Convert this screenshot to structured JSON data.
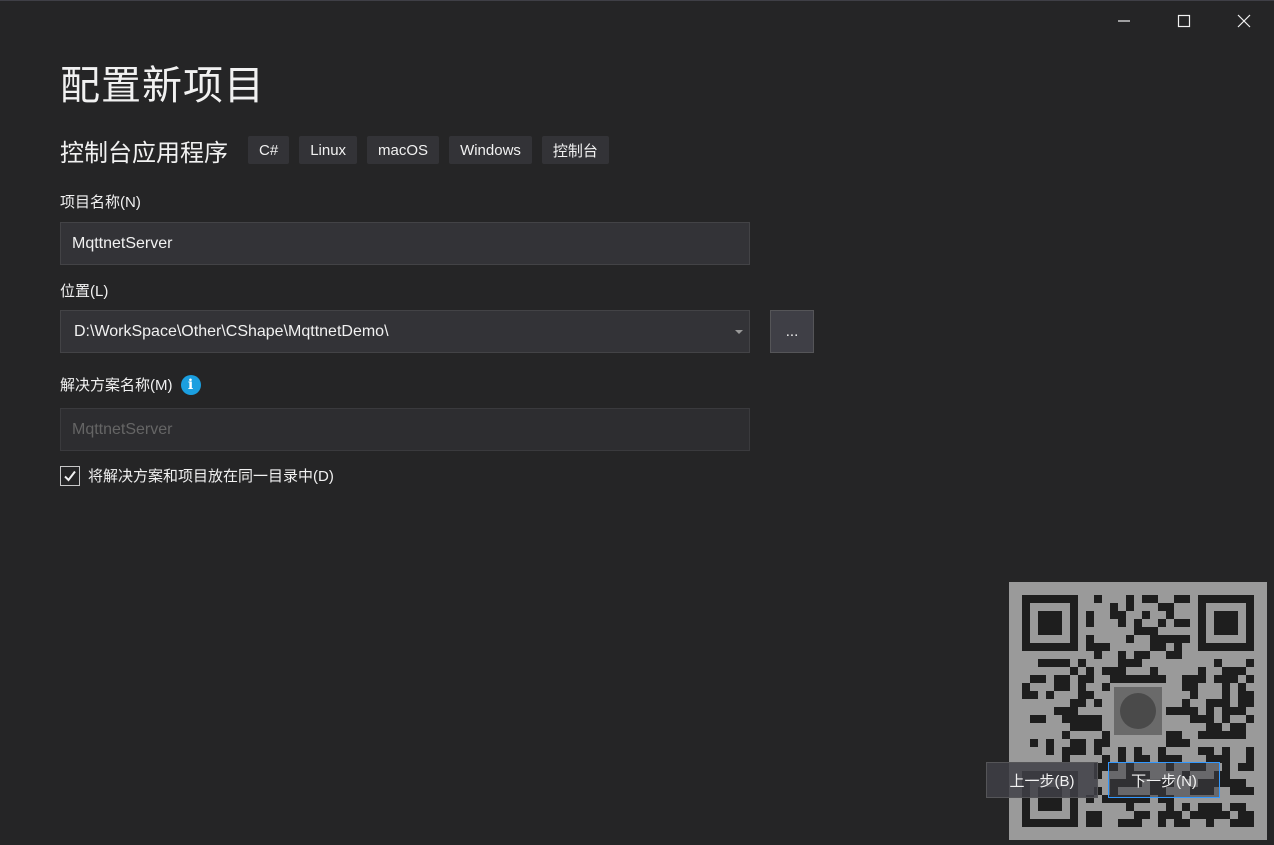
{
  "window": {
    "controls": [
      "minimize-icon",
      "maximize-icon",
      "close-icon"
    ]
  },
  "page_title": "配置新项目",
  "template": {
    "name": "控制台应用程序",
    "tags": [
      "C#",
      "Linux",
      "macOS",
      "Windows",
      "控制台"
    ]
  },
  "project_name": {
    "label": "项目名称(N)",
    "value": "MqttnetServer"
  },
  "location": {
    "label": "位置(L)",
    "value": "D:\\WorkSpace\\Other\\CShape\\MqttnetDemo\\",
    "browse_label": "..."
  },
  "solution_name": {
    "label": "解决方案名称(M)",
    "info_icon": "i",
    "placeholder": "MqttnetServer"
  },
  "same_directory": {
    "label": "将解决方案和项目放在同一目录中(D)",
    "checked": true
  },
  "footer": {
    "back_label": "上一步(B)",
    "next_label": "下一步(N)"
  },
  "colors": {
    "background": "#252526",
    "input": "#333337",
    "accent": "#3399ff",
    "info": "#1b9fe0"
  }
}
